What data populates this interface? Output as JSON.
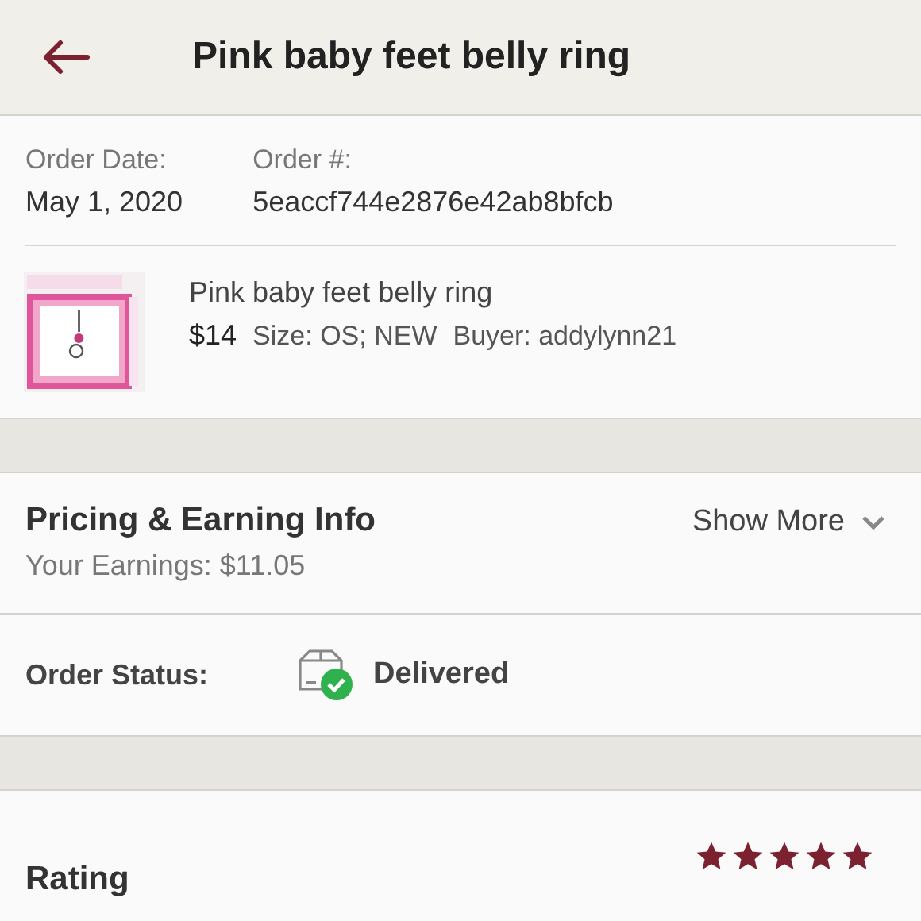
{
  "header": {
    "title": "Pink baby feet belly ring"
  },
  "order": {
    "date_label": "Order Date:",
    "date": "May 1, 2020",
    "number_label": "Order #:",
    "number": "5eaccf744e2876e42ab8bfcb"
  },
  "item": {
    "title": "Pink baby feet belly ring",
    "price": "$14",
    "details": "Size: OS; NEW",
    "buyer": "Buyer: addylynn21"
  },
  "pricing": {
    "title": "Pricing & Earning Info",
    "earnings": "Your Earnings: $11.05",
    "toggle": "Show More",
    "expanded": false
  },
  "status": {
    "label": "Order Status:",
    "value": "Delivered"
  },
  "rating": {
    "label": "Rating",
    "stars": 5
  }
}
